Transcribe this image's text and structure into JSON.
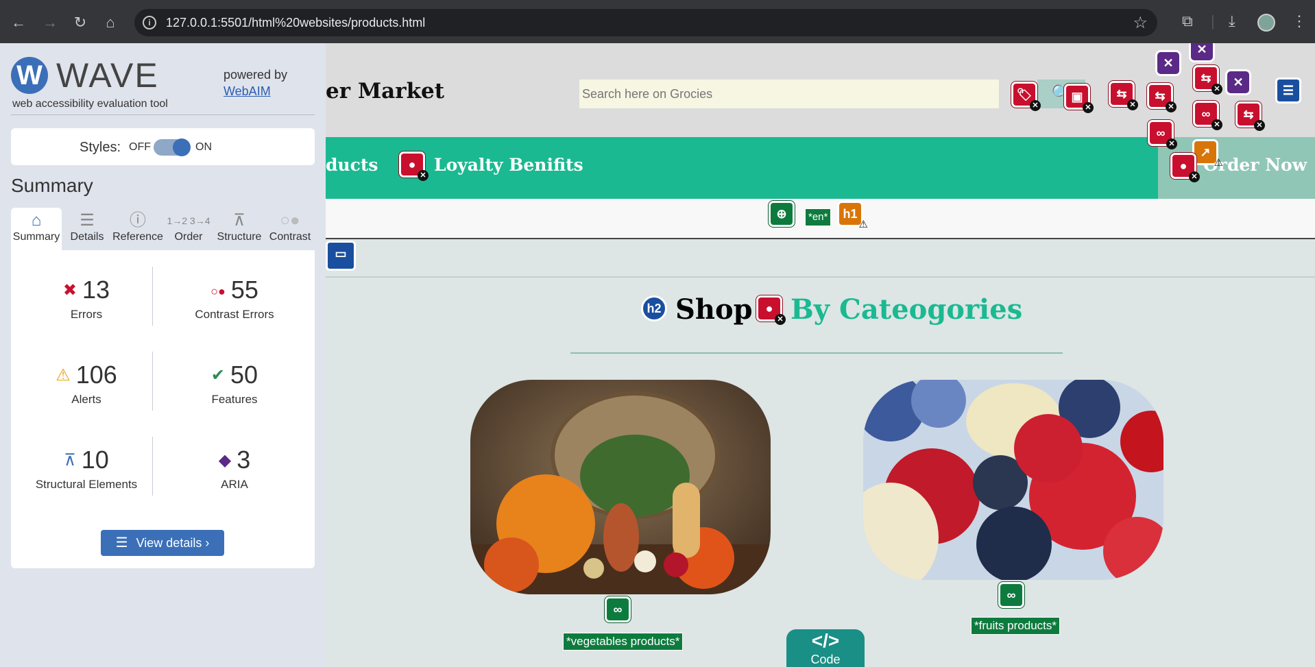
{
  "browser": {
    "url": "127.0.0.1:5501/html%20websites/products.html"
  },
  "wave": {
    "logo": "W",
    "title": "WAVE",
    "subtitle": "web accessibility evaluation tool",
    "powered_by": "powered by",
    "webaim_link": "WebAIM",
    "styles_label": "Styles:",
    "styles_off": "OFF",
    "styles_on": "ON",
    "summary_heading": "Summary",
    "tabs": [
      {
        "label": "Summary",
        "icon": "home-icon",
        "active": true
      },
      {
        "label": "Details",
        "icon": "list-icon"
      },
      {
        "label": "Reference",
        "icon": "info-icon"
      },
      {
        "label": "Order",
        "icon": "order-icon"
      },
      {
        "label": "Structure",
        "icon": "structure-icon"
      },
      {
        "label": "Contrast",
        "icon": "contrast-icon"
      }
    ],
    "stats": {
      "errors": {
        "value": "13",
        "label": "Errors",
        "color": "#c8102e"
      },
      "contrast": {
        "value": "55",
        "label": "Contrast Errors",
        "color": "#c8102e"
      },
      "alerts": {
        "value": "106",
        "label": "Alerts",
        "color": "#e8a317"
      },
      "features": {
        "value": "50",
        "label": "Features",
        "color": "#2e8b57"
      },
      "structural": {
        "value": "10",
        "label": "Structural Elements",
        "color": "#3b6fb8"
      },
      "aria": {
        "value": "3",
        "label": "ARIA",
        "color": "#5b2a86"
      }
    },
    "view_details": "View details ›"
  },
  "site": {
    "brand": "er Market",
    "search_placeholder": "Search here on Grocies",
    "nav": {
      "products": "ducts",
      "loyalty": "Loyalty Benifits",
      "order": "Order Now"
    },
    "lang_badge": "*en*",
    "h1_badge": "h1",
    "h2_badge": "h2",
    "section_title_a": "Shop",
    "section_title_b": "By Cateogories",
    "title_b_color": "#1ab991",
    "categories": [
      {
        "label": "*vegetables products*"
      },
      {
        "label": "*fruits products*"
      }
    ],
    "code_tab": "Code",
    "code_glyph": "</>"
  }
}
